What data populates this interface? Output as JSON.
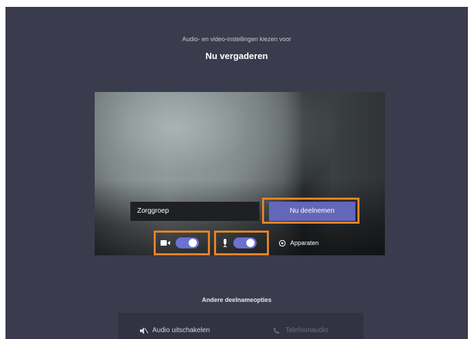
{
  "header": {
    "subtitle": "Audio- en video-instellingen kiezen voor",
    "title": "Nu vergaderen"
  },
  "preview": {
    "name_value": "Zorggroep",
    "join_label": "Nu deelnemen",
    "camera_toggle": {
      "state": "on",
      "icon": "video-camera-icon"
    },
    "mic_toggle": {
      "state": "on",
      "icon": "microphone-icon"
    },
    "devices_label": "Apparaten",
    "devices_icon": "gear-icon"
  },
  "other_options": {
    "heading": "Andere deelnameopties",
    "audio_off_label": "Audio uitschakelen",
    "audio_off_icon": "speaker-off-icon",
    "phone_audio_label": "Telefoonaudio",
    "phone_audio_icon": "phone-icon"
  },
  "colors": {
    "background": "#3a3b4d",
    "accent": "#6467b8",
    "toggle_on": "#6c70d0",
    "highlight": "#e3832a"
  }
}
